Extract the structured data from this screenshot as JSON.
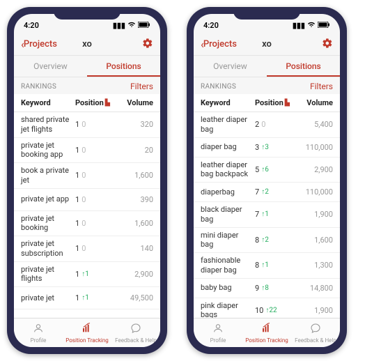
{
  "status": {
    "time": "4:20"
  },
  "nav": {
    "back": "Projects",
    "title": "xo"
  },
  "tabs": {
    "overview": "Overview",
    "positions": "Positions"
  },
  "subhead": {
    "rankings": "RANKINGS",
    "filters": "Filters"
  },
  "cols": {
    "keyword": "Keyword",
    "position": "Position",
    "volume": "Volume"
  },
  "tabbar": {
    "profile": "Profile",
    "tracking": "Position Tracking",
    "feedback": "Feedback & Help"
  },
  "left_rows": [
    {
      "kw": "shared private jet flights",
      "pos": "1",
      "chg": "0",
      "up": false,
      "vol": "320"
    },
    {
      "kw": "private jet booking app",
      "pos": "1",
      "chg": "0",
      "up": false,
      "vol": "20"
    },
    {
      "kw": "book a private jet",
      "pos": "1",
      "chg": "0",
      "up": false,
      "vol": "1,600"
    },
    {
      "kw": "private jet app",
      "pos": "1",
      "chg": "0",
      "up": false,
      "vol": "390"
    },
    {
      "kw": "private jet booking",
      "pos": "1",
      "chg": "0",
      "up": false,
      "vol": "1,600"
    },
    {
      "kw": "private jet subscription",
      "pos": "1",
      "chg": "0",
      "up": false,
      "vol": "140"
    },
    {
      "kw": "private jet flights",
      "pos": "1",
      "chg": "1",
      "up": true,
      "vol": "2,900"
    },
    {
      "kw": "private jet",
      "pos": "1",
      "chg": "1",
      "up": true,
      "vol": "49,500"
    }
  ],
  "right_rows": [
    {
      "kw": "leather diaper bag",
      "pos": "2",
      "chg": "0",
      "up": false,
      "vol": "5,400"
    },
    {
      "kw": "diaper bag",
      "pos": "3",
      "chg": "3",
      "up": true,
      "vol": "110,000"
    },
    {
      "kw": "leather diaper bag backpack",
      "pos": "5",
      "chg": "6",
      "up": true,
      "vol": "2,900"
    },
    {
      "kw": "diaperbag",
      "pos": "7",
      "chg": "2",
      "up": true,
      "vol": "110,000"
    },
    {
      "kw": "black diaper bag",
      "pos": "7",
      "chg": "1",
      "up": true,
      "vol": "1,900"
    },
    {
      "kw": "mini diaper bag",
      "pos": "8",
      "chg": "2",
      "up": true,
      "vol": "1,600"
    },
    {
      "kw": "fashionable diaper bag",
      "pos": "8",
      "chg": "1",
      "up": true,
      "vol": "1,300"
    },
    {
      "kw": "baby bag",
      "pos": "9",
      "chg": "8",
      "up": true,
      "vol": "14,800"
    },
    {
      "kw": "pink diaper bags",
      "pos": "10",
      "chg": "22",
      "up": true,
      "vol": "1,900"
    }
  ]
}
